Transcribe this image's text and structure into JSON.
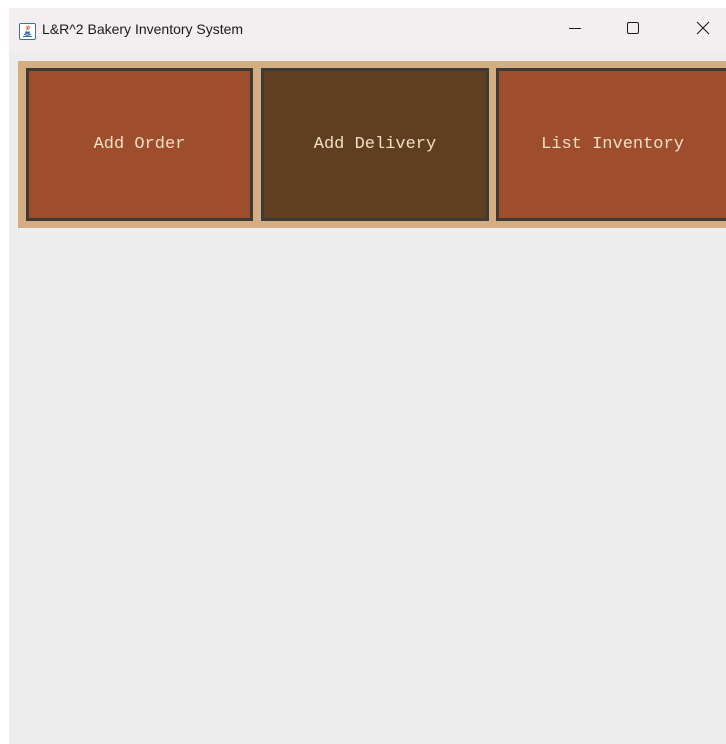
{
  "window": {
    "title": "L&R^2 Bakery Inventory System",
    "icon": "java-cup-icon",
    "controls": {
      "minimize": "minimize-icon",
      "maximize": "maximize-icon",
      "close": "close-icon"
    }
  },
  "buttons": {
    "add_order": "Add Order",
    "add_delivery": "Add Delivery",
    "list_inventory": "List Inventory"
  },
  "colors": {
    "button_bar_background": "#d4ae80",
    "button_primary": "#9e4e2c",
    "button_active": "#5f3f1f",
    "button_text": "#f2dfc5",
    "button_border": "#3d3b38"
  }
}
